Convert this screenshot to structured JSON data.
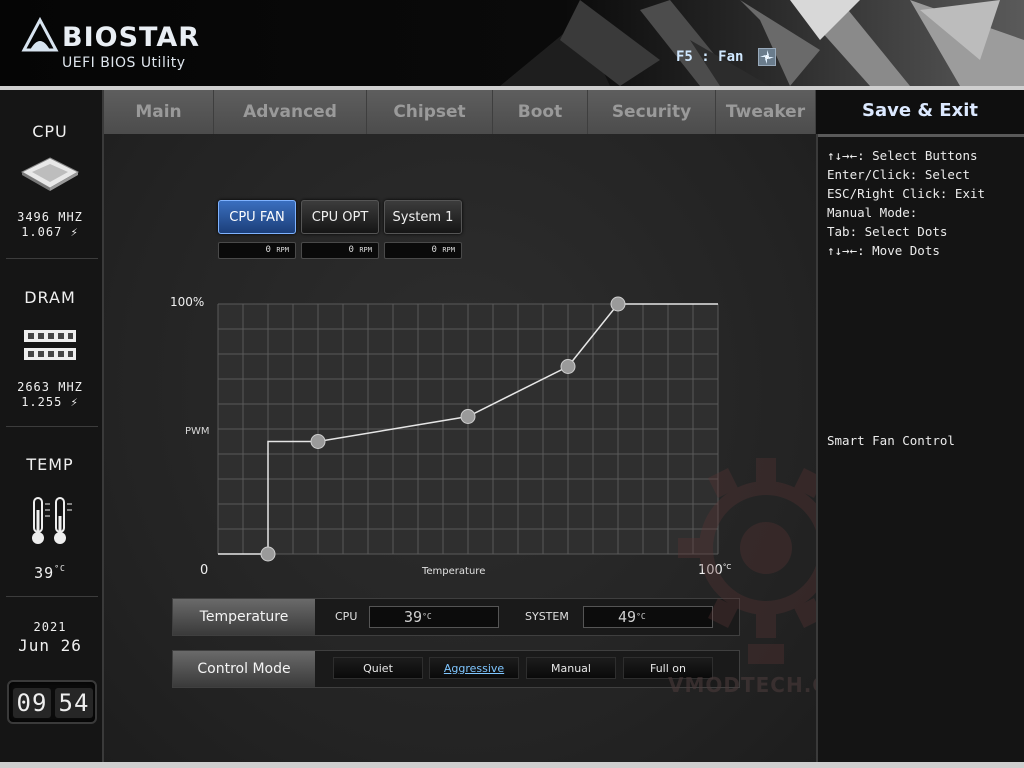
{
  "header": {
    "brand": "BIOSTAR",
    "subtitle": "UEFI BIOS Utility",
    "hotkey": "F5 : Fan"
  },
  "sidebar": {
    "cpu": {
      "title": "CPU",
      "freq": "3496 MHZ",
      "volt": "1.067"
    },
    "dram": {
      "title": "DRAM",
      "freq": "2663 MHZ",
      "volt": "1.255"
    },
    "temp": {
      "title": "TEMP",
      "value": "39"
    },
    "date": {
      "year": "2021",
      "month_day": "Jun 26"
    },
    "clock": {
      "hour": "09",
      "minute": "54"
    }
  },
  "tabs": [
    {
      "label": "Main"
    },
    {
      "label": "Advanced"
    },
    {
      "label": "Chipset"
    },
    {
      "label": "Boot"
    },
    {
      "label": "Security"
    },
    {
      "label": "Tweaker"
    }
  ],
  "active_tab": {
    "label": "Save & Exit"
  },
  "fans": [
    {
      "label": "CPU FAN",
      "rpm": "0",
      "active": true
    },
    {
      "label": "CPU OPT",
      "rpm": "0",
      "active": false
    },
    {
      "label": "System 1",
      "rpm": "0",
      "active": false
    }
  ],
  "rpm_unit": "RPM",
  "graph": {
    "y_max_label": "100%",
    "y_label": "PWM",
    "origin_label": "0",
    "x_label": "Temperature",
    "x_max_label": "100",
    "curve_points": [
      {
        "temp": 10,
        "pwm": 0
      },
      {
        "temp": 20,
        "pwm": 45
      },
      {
        "temp": 50,
        "pwm": 55
      },
      {
        "temp": 70,
        "pwm": 75
      },
      {
        "temp": 80,
        "pwm": 100
      }
    ]
  },
  "temperature_panel": {
    "label": "Temperature",
    "cpu_caption": "CPU",
    "cpu_value": "39",
    "system_caption": "SYSTEM",
    "system_value": "49"
  },
  "control_mode": {
    "label": "Control Mode",
    "options": [
      "Quiet",
      "Aggressive",
      "Manual",
      "Full on"
    ],
    "selected": "Aggressive"
  },
  "help": {
    "lines": [
      "↑↓→←: Select Buttons",
      "Enter/Click: Select",
      "ESC/Right Click: Exit",
      "Manual Mode:",
      "Tab: Select Dots",
      "↑↓→←: Move Dots"
    ],
    "description": "Smart Fan Control"
  },
  "watermark": "VMODTECH.COM"
}
